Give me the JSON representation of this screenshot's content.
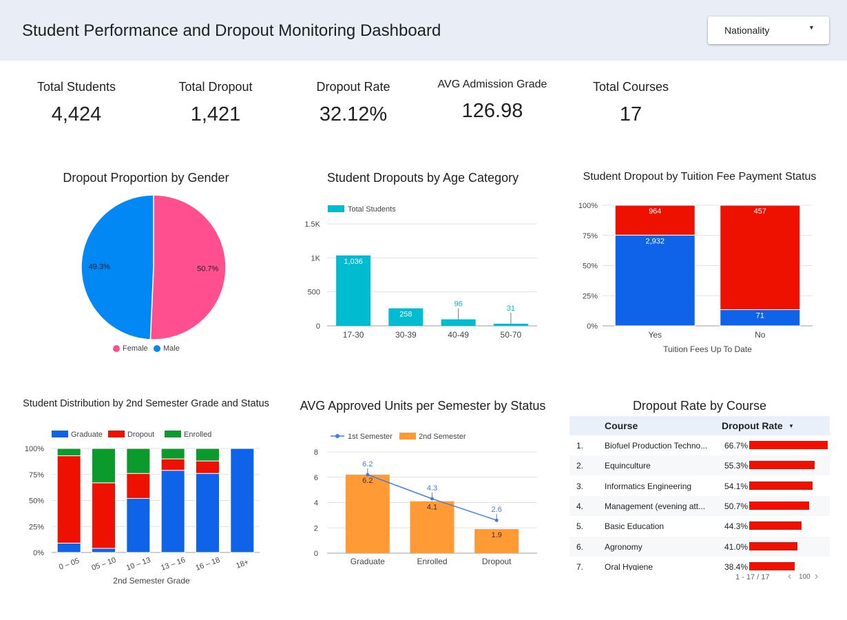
{
  "header": {
    "title": "Student Performance and Dropout Monitoring Dashboard",
    "filter_label": "Nationality"
  },
  "kpis": [
    {
      "label": "Total Students",
      "value": "4,424"
    },
    {
      "label": "Total Dropout",
      "value": "1,421"
    },
    {
      "label": "Dropout Rate",
      "value": "32.12%"
    },
    {
      "label": "AVG Admission Grade",
      "value": "126.98"
    },
    {
      "label": "Total Courses",
      "value": "17"
    }
  ],
  "colors": {
    "female": "#ff4f8f",
    "male": "#0288f5",
    "teal": "#00bcd0",
    "graduate": "#0e63e8",
    "dropout": "#ee1100",
    "enrolled": "#0b9a2c",
    "orange": "#ff9a35",
    "line_blue": "#3d7df0"
  },
  "titles": {
    "gender": "Dropout Proportion by Gender",
    "age": "Student Dropouts by Age Category",
    "tuition": "Student Dropout by Tuition Fee Payment Status",
    "grade": "Student Distribution by 2nd Semester Grade and Status",
    "units": "AVG Approved Units per Semester by Status",
    "course": "Dropout Rate by Course"
  },
  "chart_data": [
    {
      "id": "gender",
      "type": "pie",
      "title": "Dropout Proportion by Gender",
      "slices": [
        {
          "name": "Female",
          "value": 50.7,
          "label": "50.7%"
        },
        {
          "name": "Male",
          "value": 49.3,
          "label": "49.3%"
        }
      ],
      "legend": "bottom"
    },
    {
      "id": "age",
      "type": "bar",
      "title": "Student Dropouts by Age Category",
      "categories": [
        "17-30",
        "30-39",
        "40-49",
        "50-70"
      ],
      "series": [
        {
          "name": "Total Students",
          "values": [
            1036,
            258,
            96,
            31
          ]
        }
      ],
      "value_labels": [
        "1,036",
        "258",
        "96",
        "31"
      ],
      "ylim": [
        0,
        1500
      ],
      "yticks": [
        0,
        500,
        1000,
        1500
      ],
      "ytick_labels": [
        "0",
        "500",
        "1K",
        "1.5K"
      ],
      "legend": "top-left"
    },
    {
      "id": "tuition",
      "type": "bar",
      "stacked": "percent",
      "title": "Student Dropout by Tuition Fee Payment Status",
      "xlabel": "Tuition Fees Up To Date",
      "categories": [
        "Yes",
        "No"
      ],
      "series": [
        {
          "values": [
            2932,
            71
          ],
          "labels": [
            "2,932",
            "71"
          ]
        },
        {
          "values": [
            964,
            457
          ],
          "labels": [
            "964",
            "457"
          ]
        }
      ],
      "ytick_labels": [
        "0%",
        "25%",
        "50%",
        "75%",
        "100%"
      ]
    },
    {
      "id": "grade",
      "type": "bar",
      "stacked": "percent",
      "title": "Student Distribution by 2nd Semester Grade and Status",
      "xlabel": "2nd Semester Grade",
      "categories": [
        "0 – 05",
        "05 – 10",
        "10 – 13",
        "13 – 16",
        "16 – 18",
        "18+"
      ],
      "series": [
        {
          "name": "Graduate",
          "values": [
            9,
            4,
            52,
            79,
            76,
            100
          ]
        },
        {
          "name": "Dropout",
          "values": [
            84,
            63,
            24,
            11,
            12,
            0
          ]
        },
        {
          "name": "Enrolled",
          "values": [
            7,
            33,
            24,
            10,
            12,
            0
          ]
        }
      ],
      "ytick_labels": [
        "0%",
        "25%",
        "50%",
        "75%",
        "100%"
      ],
      "legend": "top-left"
    },
    {
      "id": "units",
      "type": "bar",
      "title": "AVG Approved Units per Semester by Status",
      "categories": [
        "Graduate",
        "Enrolled",
        "Dropout"
      ],
      "series": [
        {
          "name": "1st Semester",
          "type": "line",
          "values": [
            6.2,
            4.3,
            2.6
          ],
          "labels": [
            "6.2",
            "4.3",
            "2.6"
          ]
        },
        {
          "name": "2nd Semester",
          "type": "bar",
          "values": [
            6.2,
            4.1,
            1.9
          ],
          "labels": [
            "6.2",
            "4.1",
            "1.9"
          ]
        }
      ],
      "ylim": [
        0,
        8
      ],
      "yticks": [
        0,
        2,
        4,
        6,
        8
      ],
      "ytick_labels": [
        "0",
        "2",
        "4",
        "6",
        "8"
      ],
      "legend": "top-left"
    },
    {
      "id": "course",
      "type": "table",
      "title": "Dropout Rate by Course",
      "columns": [
        "Course",
        "Dropout Rate"
      ],
      "rows": [
        {
          "rank": "1.",
          "course": "Biofuel Production Techno...",
          "rate": 66.7,
          "label": "66.7%"
        },
        {
          "rank": "2.",
          "course": "Equinculture",
          "rate": 55.3,
          "label": "55.3%"
        },
        {
          "rank": "3.",
          "course": "Informatics Engineering",
          "rate": 54.1,
          "label": "54.1%"
        },
        {
          "rank": "4.",
          "course": "Management (evening att...",
          "rate": 50.7,
          "label": "50.7%"
        },
        {
          "rank": "5.",
          "course": "Basic Education",
          "rate": 44.3,
          "label": "44.3%"
        },
        {
          "rank": "6.",
          "course": "Agronomy",
          "rate": 41.0,
          "label": "41.0%"
        },
        {
          "rank": "7.",
          "course": "Oral Hygiene",
          "rate": 38.4,
          "label": "38.4%"
        }
      ],
      "pager": {
        "range": "1 - 17 / 17",
        "page_size": "100"
      }
    }
  ]
}
